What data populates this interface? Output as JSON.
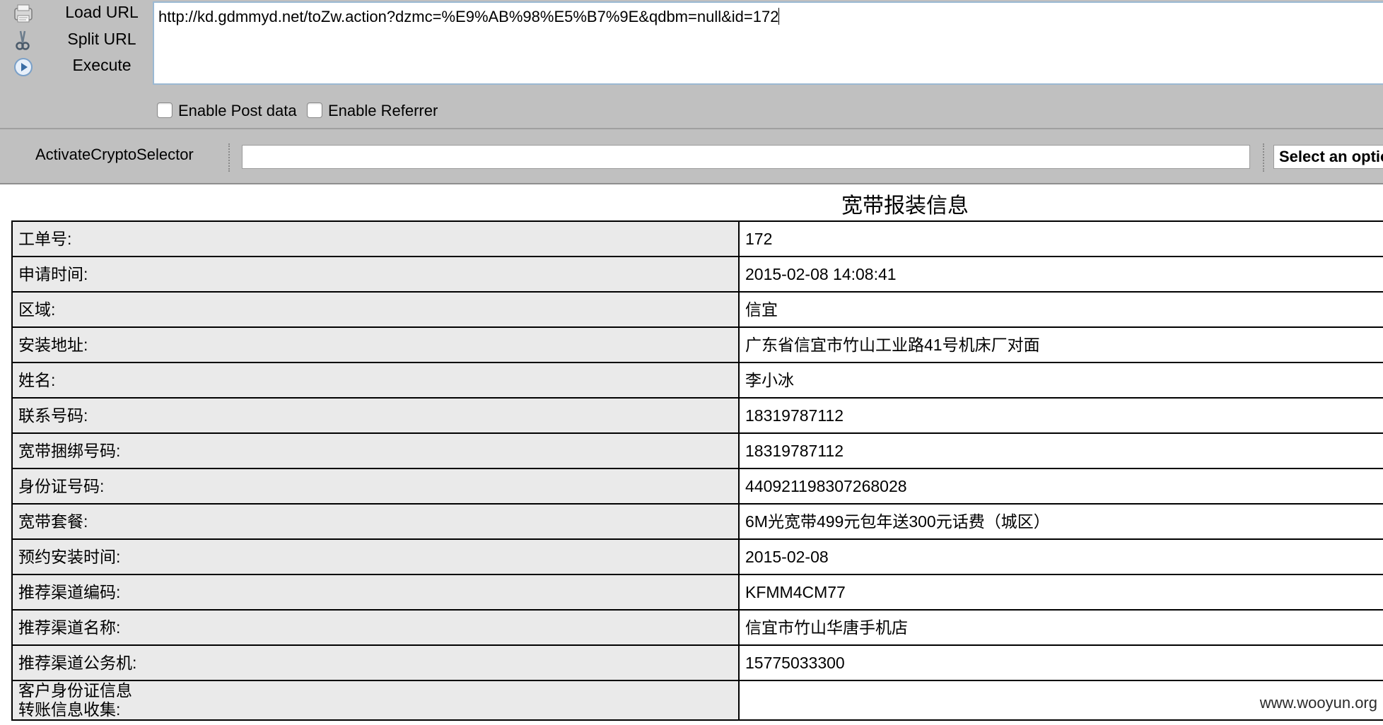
{
  "hackbar": {
    "buttons": [
      {
        "label": "Load URL",
        "icon": "load-url-icon"
      },
      {
        "label": "Split URL",
        "icon": "scissors-icon"
      },
      {
        "label": "Execute",
        "icon": "play-icon"
      }
    ],
    "url": "http://kd.gdmmyd.net/toZw.action?dzmc=%E9%AB%98%E5%B7%9E&qdbm=null&id=172",
    "enable_post_label": "Enable Post data",
    "enable_referrer_label": "Enable Referrer"
  },
  "crypto": {
    "label": "ActivateCryptoSelector",
    "input_value": "",
    "select_value": "Select an option"
  },
  "page": {
    "title": "宽带报装信息",
    "rows": [
      {
        "key": "工单号:",
        "value": "172"
      },
      {
        "key": "申请时间:",
        "value": "2015-02-08 14:08:41"
      },
      {
        "key": "区域:",
        "value": "信宜"
      },
      {
        "key": "安装地址:",
        "value": "广东省信宜市竹山工业路41号机床厂对面"
      },
      {
        "key": "姓名:",
        "value": "李小冰"
      },
      {
        "key": "联系号码:",
        "value": "18319787112"
      },
      {
        "key": "宽带捆绑号码:",
        "value": "18319787112"
      },
      {
        "key": "身份证号码:",
        "value": "440921198307268028"
      },
      {
        "key": "宽带套餐:",
        "value": "6M光宽带499元包年送300元话费（城区）"
      },
      {
        "key": "预约安装时间:",
        "value": "2015-02-08"
      },
      {
        "key": "推荐渠道编码:",
        "value": "KFMM4CM77"
      },
      {
        "key": "推荐渠道名称:",
        "value": "信宜市竹山华唐手机店"
      },
      {
        "key": "推荐渠道公务机:",
        "value": "15775033300"
      }
    ],
    "last_row": {
      "key_line1": "客户身份证信息",
      "key_line2": "转账信息收集:",
      "value": ""
    }
  },
  "watermark": "www.wooyun.org"
}
